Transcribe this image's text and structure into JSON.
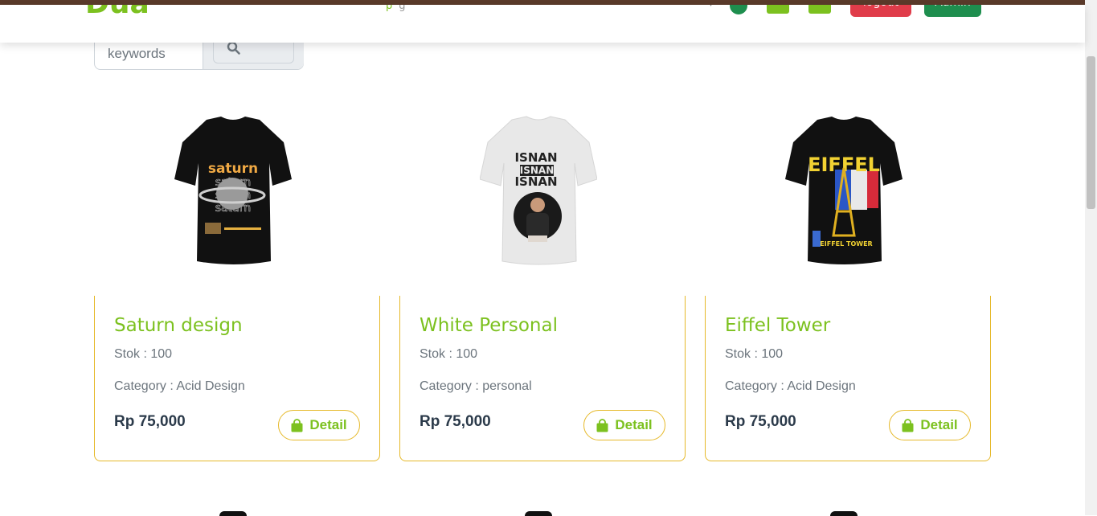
{
  "navbar": {
    "brand": "Dua",
    "links": [
      "p",
      "g"
    ],
    "logout_label": "logout",
    "admin_label": "Admin"
  },
  "search": {
    "placeholder": "keywords",
    "value": ""
  },
  "products": [
    {
      "title": "Saturn design",
      "stock": "Stok : 100",
      "category": "Category : Acid Design",
      "price": "Rp 75,000",
      "detail_label": "Detail",
      "shirt_color": "#111111",
      "shirt_text": "saturn"
    },
    {
      "title": "White Personal",
      "stock": "Stok : 100",
      "category": "Category : personal",
      "price": "Rp 75,000",
      "detail_label": "Detail",
      "shirt_color": "#e8e8e8",
      "shirt_text": "ISNAN"
    },
    {
      "title": "Eiffel Tower",
      "stock": "Stok : 100",
      "category": "Category : Acid Design",
      "price": "Rp 75,000",
      "detail_label": "Detail",
      "shirt_color": "#111111",
      "shirt_text": "EIFFEL"
    }
  ],
  "colors": {
    "brand_green": "#7cc11f",
    "dark_green": "#1e8e4e",
    "red": "#e03c4a",
    "card_border": "#e6b92a"
  },
  "icons": [
    "search-icon",
    "shopping-bag-icon"
  ]
}
